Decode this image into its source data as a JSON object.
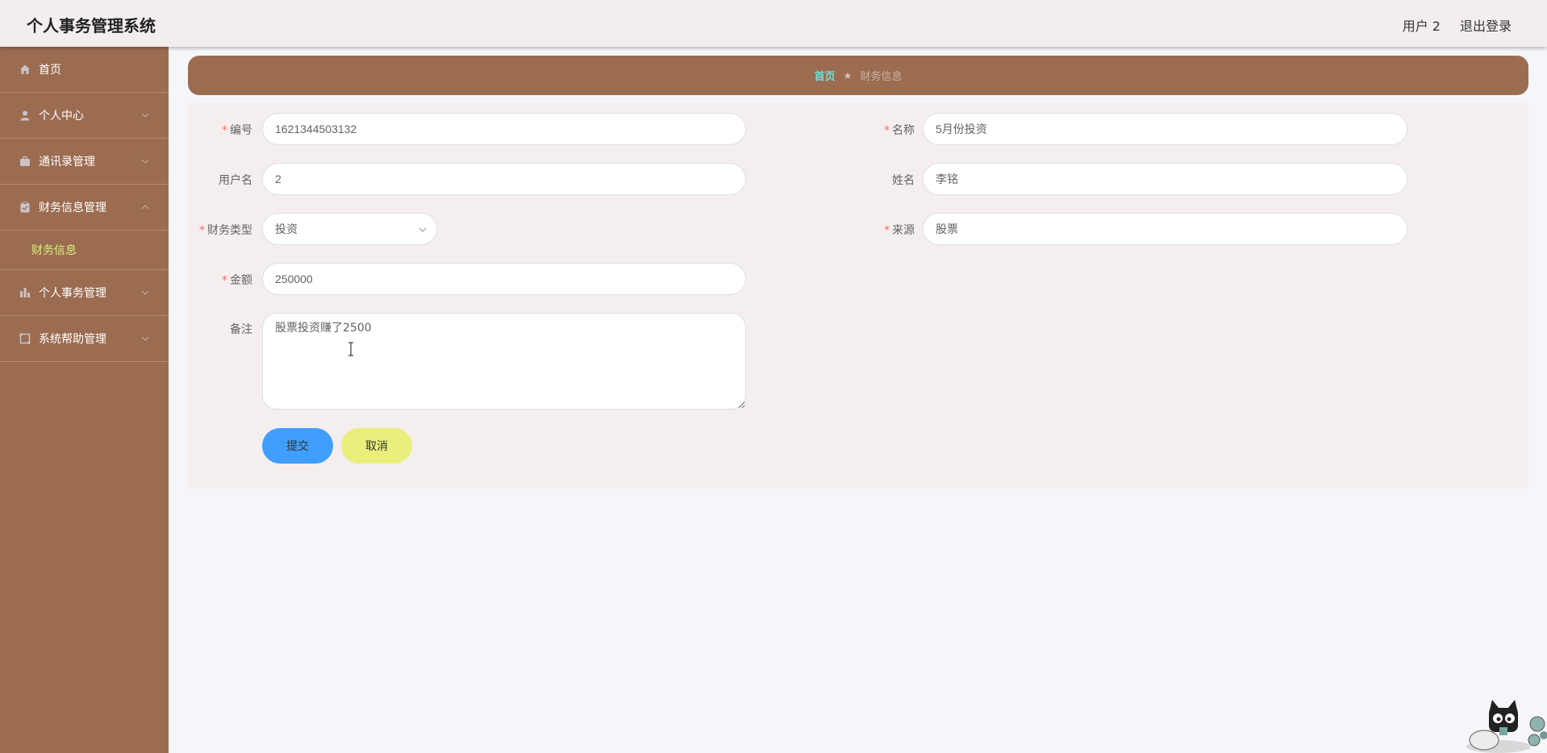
{
  "header": {
    "app_title": "个人事务管理系统",
    "user_label": "用户 2",
    "logout_label": "退出登录"
  },
  "sidebar": {
    "items": [
      {
        "label": "首页",
        "icon": "home-icon"
      },
      {
        "label": "个人中心",
        "icon": "user-icon"
      },
      {
        "label": "通讯录管理",
        "icon": "briefcase-icon"
      },
      {
        "label": "财务信息管理",
        "icon": "clipboard-icon"
      },
      {
        "label": "个人事务管理",
        "icon": "bar-chart-icon"
      },
      {
        "label": "系统帮助管理",
        "icon": "help-square-icon"
      }
    ],
    "submenu": {
      "label": "财务信息"
    }
  },
  "breadcrumb": {
    "home": "首页",
    "separator": "★",
    "current": "财务信息"
  },
  "form": {
    "number": {
      "label": "编号",
      "value": "1621344503132"
    },
    "name": {
      "label": "名称",
      "value": "5月份投资"
    },
    "username": {
      "label": "用户名",
      "value": "2"
    },
    "realname": {
      "label": "姓名",
      "value": "李铭"
    },
    "finance_type": {
      "label": "财务类型",
      "value": "投资"
    },
    "source": {
      "label": "来源",
      "value": "股票"
    },
    "amount": {
      "label": "金额",
      "value": "250000"
    },
    "remark": {
      "label": "备注",
      "value": "股票投资赚了2500"
    },
    "required_mark": "*",
    "submit_label": "提交",
    "cancel_label": "取消"
  },
  "colors": {
    "sidebar_bg": "#9c6c51",
    "breadcrumb_bg": "#9c6c51",
    "submenu_active": "#d7f27a",
    "breadcrumb_home": "#6ce0d8",
    "submit_bg": "#409eff",
    "cancel_bg": "#e9ef7a",
    "required": "#f56c6c"
  }
}
